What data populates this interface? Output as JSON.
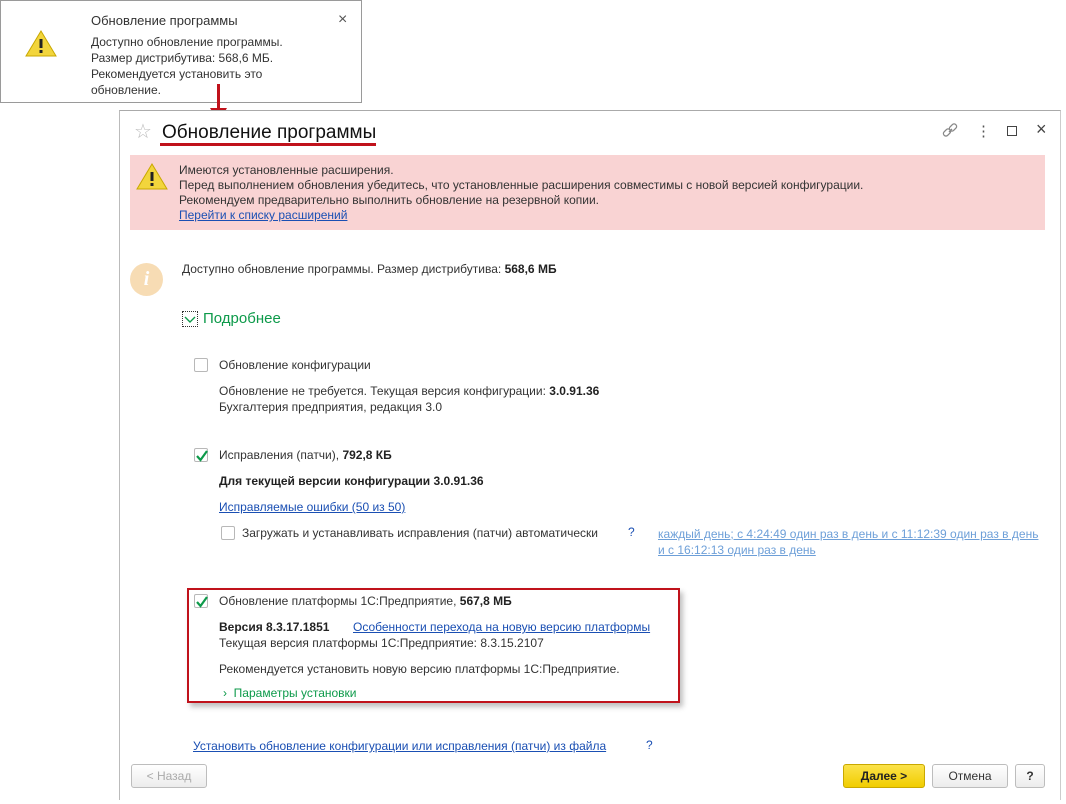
{
  "notification": {
    "title": "Обновление программы",
    "lines": [
      "Доступно обновление программы.",
      "Размер дистрибутива: 568,6 МБ.",
      "Рекомендуется установить это",
      "обновление."
    ],
    "close": "×"
  },
  "window": {
    "title": "Обновление программы",
    "link_icon": "link-icon",
    "more": "⋮",
    "maximize": "□",
    "close": "×"
  },
  "warning": {
    "lines": [
      "Имеются установленные расширения.",
      "Перед выполнением обновления убедитесь, что установленные расширения совместимы с новой версией конфигурации.",
      "Рекомендуем предварительно выполнить обновление на резервной копии."
    ],
    "link": "Перейти к списку расширений"
  },
  "info": {
    "text": "Доступно обновление программы. Размер дистрибутива: ",
    "size": "568,6 МБ"
  },
  "details": {
    "label": "Подробнее"
  },
  "config": {
    "label": "Обновление конфигурации",
    "text": "Обновление не требуется. Текущая версия конфигурации: ",
    "version": "3.0.91.36",
    "edition": "Бухгалтерия предприятия, редакция 3.0",
    "checked": false
  },
  "patches": {
    "label": "Исправления (патчи), ",
    "size": "792,8 КБ",
    "for_version": "Для текущей версии конфигурации 3.0.91.36",
    "errors_link": "Исправляемые ошибки (50 из 50)",
    "auto_label": "Загружать и устанавливать исправления (патчи) автоматически",
    "help": "?",
    "schedule_link": "каждый день; с 4:24:49 один раз в день и с 11:12:39 один раз в день и с 16:12:13 один раз в день",
    "checked": true
  },
  "platform": {
    "label": "Обновление платформы 1С:Предприятие, ",
    "size": "567,8 МБ",
    "version": "Версия 8.3.17.1851",
    "features_link": "Особенности перехода на новую версию платформы",
    "current": "Текущая версия платформы 1С:Предприятие: 8.3.15.2107",
    "recommend": "Рекомендуется установить новую версию платформы 1С:Предприятие.",
    "params": "Параметры установки",
    "checked": true
  },
  "footer": {
    "file_link": "Установить обновление конфигурации или исправления (патчи) из файла",
    "help": "?",
    "back": "< Назад",
    "next": "Далее >",
    "cancel": "Отмена",
    "question": "?"
  },
  "colors": {
    "annotation": "#c0121b",
    "warning_bg": "#f9d3d3",
    "accent": "#f3d200",
    "green": "#0d9a4a"
  }
}
